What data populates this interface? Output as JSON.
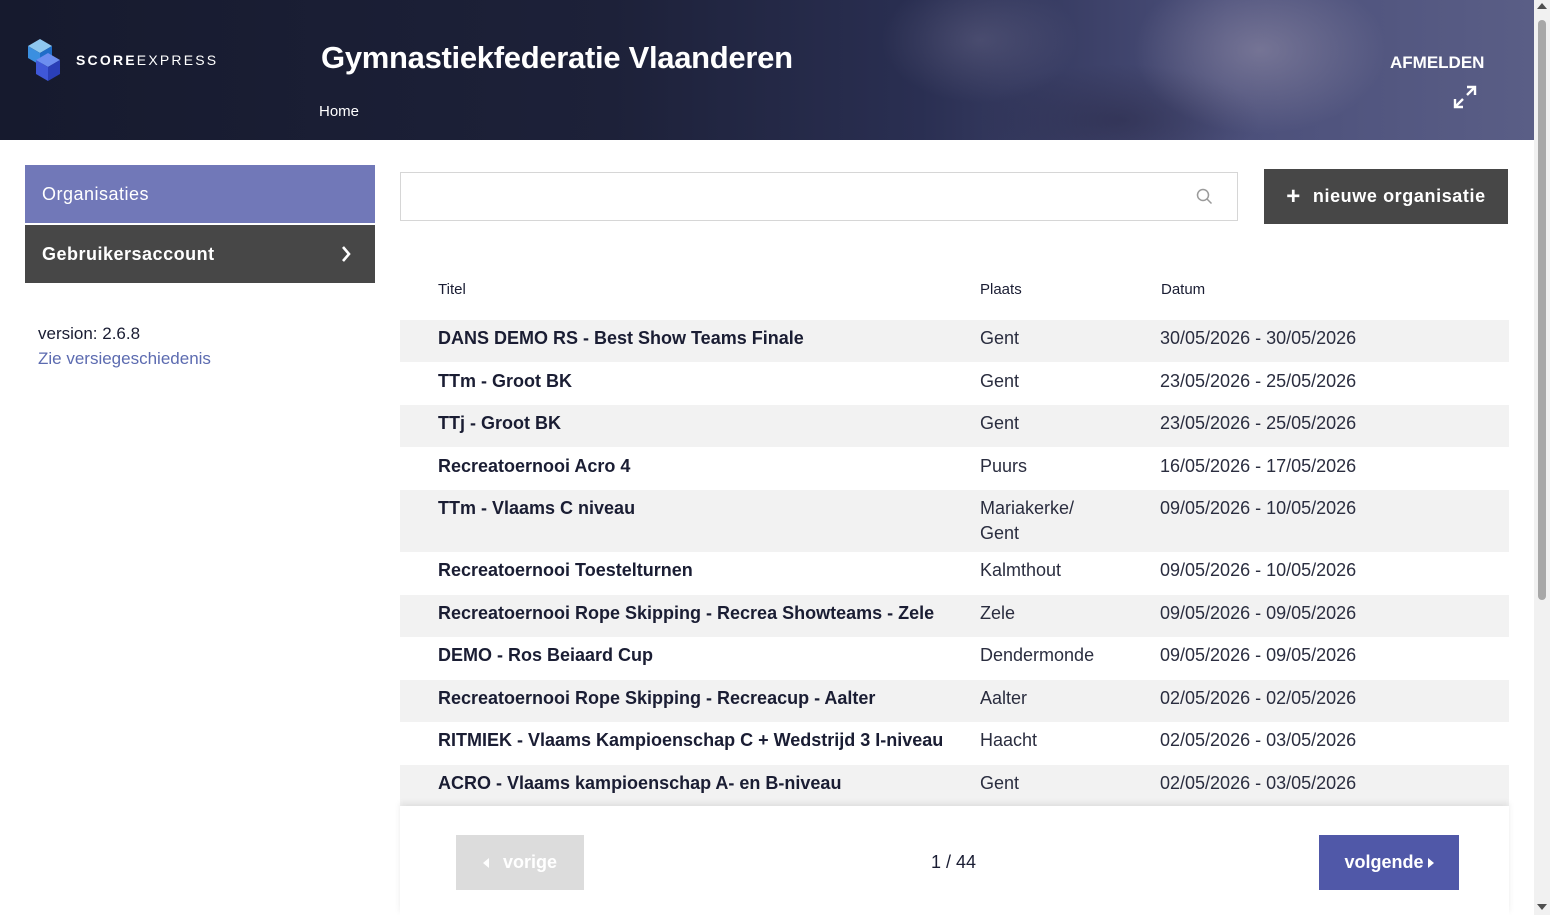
{
  "header": {
    "logo_text_bold": "SCORE",
    "logo_text_rest": "EXPRESS",
    "org_title": "Gymnastiekfederatie Vlaanderen",
    "nav_home": "Home",
    "logout_label": "AFMELDEN",
    "fullscreen_icon": "expand-icon"
  },
  "sidebar": {
    "items": [
      {
        "label": "Organisaties"
      },
      {
        "label": "Gebruikersaccount"
      }
    ],
    "version": "version: 2.6.8",
    "history_link": "Zie versiegeschiedenis"
  },
  "search": {
    "value": "",
    "placeholder": "",
    "icon": "search-icon"
  },
  "new_org_button": {
    "label": "nieuwe organisatie",
    "icon": "plus-icon"
  },
  "table": {
    "columns": [
      "Titel",
      "Plaats",
      "Datum"
    ],
    "rows": [
      {
        "title": "DANS DEMO RS - Best Show Teams Finale",
        "place": "Gent",
        "date": "30/05/2026 - 30/05/2026"
      },
      {
        "title": "TTm - Groot BK",
        "place": "Gent",
        "date": "23/05/2026 - 25/05/2026"
      },
      {
        "title": "TTj - Groot BK",
        "place": "Gent",
        "date": "23/05/2026 - 25/05/2026"
      },
      {
        "title": "Recreatoernooi Acro 4",
        "place": "Puurs",
        "date": "16/05/2026 - 17/05/2026"
      },
      {
        "title": "TTm - Vlaams C niveau",
        "place": "Mariakerke/ Gent",
        "date": "09/05/2026 - 10/05/2026"
      },
      {
        "title": "Recreatoernooi Toestelturnen",
        "place": "Kalmthout",
        "date": "09/05/2026 - 10/05/2026"
      },
      {
        "title": "Recreatoernooi Rope Skipping - Recrea Showteams - Zele",
        "place": "Zele",
        "date": "09/05/2026 - 09/05/2026"
      },
      {
        "title": "DEMO - Ros Beiaard Cup",
        "place": "Dendermonde",
        "date": "09/05/2026 - 09/05/2026"
      },
      {
        "title": "Recreatoernooi Rope Skipping - Recreacup - Aalter",
        "place": "Aalter",
        "date": "02/05/2026 - 02/05/2026"
      },
      {
        "title": "RITMIEK - Vlaams Kampioenschap C + Wedstrijd 3 I-niveau",
        "place": "Haacht",
        "date": "02/05/2026 - 03/05/2026"
      },
      {
        "title": "ACRO - Vlaams kampioenschap A- en B-niveau",
        "place": "Gent",
        "date": "02/05/2026 - 03/05/2026"
      }
    ]
  },
  "pagination": {
    "prev_label": "vorige",
    "next_label": "volgende",
    "page_indicator": "1 / 44"
  },
  "colors": {
    "accent": "#7178b8",
    "primary_button": "#5058a8",
    "dark_button": "#474747",
    "header_bg": "#1d2139"
  }
}
